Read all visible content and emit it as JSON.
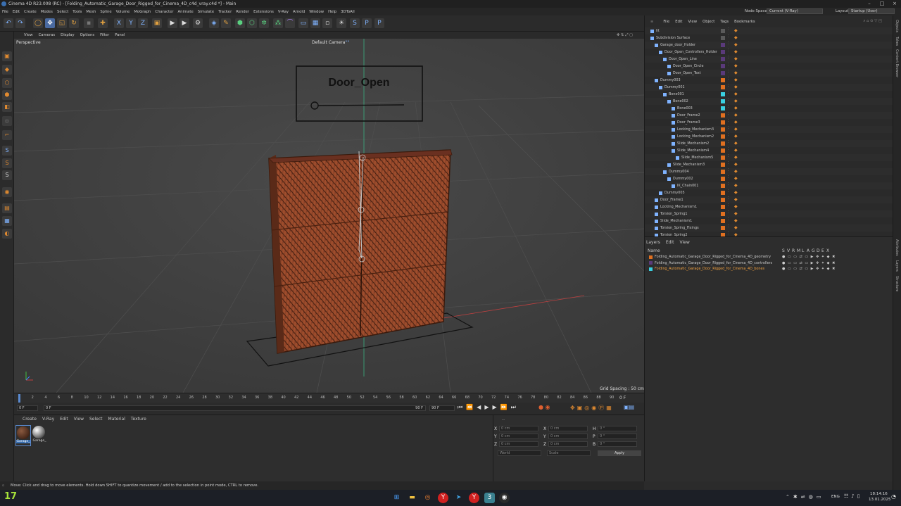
{
  "titlebar": {
    "title": "Cinema 4D R23.008 (RC) - [Folding_Automatic_Garage_Door_Rigged_for_Cinema_4D_c4d_vray.c4d *] - Main"
  },
  "menubar": {
    "items": [
      "File",
      "Edit",
      "Create",
      "Modes",
      "Select",
      "Tools",
      "Mesh",
      "Spline",
      "Volume",
      "MoGraph",
      "Character",
      "Animate",
      "Simulate",
      "Tracker",
      "Render",
      "Extensions",
      "V-Ray",
      "Arnold",
      "Window",
      "Help",
      "3DToAll"
    ],
    "node_space_label": "Node Space:",
    "node_space_value": "Current (V-Ray)",
    "layout_label": "Layout:",
    "layout_value": "Startup (User)"
  },
  "viewport": {
    "menu": [
      "View",
      "Cameras",
      "Display",
      "Options",
      "Filter",
      "Panel"
    ],
    "view_name": "Perspective",
    "camera": "Default Camera",
    "camera_suffix": "°°",
    "grid_spacing": "Grid Spacing : 50 cm",
    "sign_text": "Door_Open"
  },
  "timeline": {
    "ticks": [
      "0",
      "2",
      "4",
      "6",
      "8",
      "10",
      "12",
      "14",
      "16",
      "18",
      "20",
      "22",
      "24",
      "26",
      "28",
      "30",
      "32",
      "34",
      "36",
      "38",
      "40",
      "42",
      "44",
      "46",
      "48",
      "50",
      "52",
      "54",
      "56",
      "58",
      "60",
      "62",
      "64",
      "66",
      "68",
      "70",
      "72",
      "74",
      "76",
      "78",
      "80",
      "82",
      "84",
      "86",
      "88",
      "90"
    ],
    "current_frame": "0 F"
  },
  "transport": {
    "start": "0 F",
    "range_start": "0 F",
    "range_end": "90 F",
    "end": "90 F"
  },
  "materials": {
    "menu": [
      "Create",
      "V-Ray",
      "Edit",
      "View",
      "Select",
      "Material",
      "Texture"
    ],
    "items": [
      {
        "name": "Garage_"
      },
      {
        "name": "Garage_"
      }
    ]
  },
  "coordinates": {
    "header": "--",
    "rows": [
      {
        "a": "X",
        "av": "0 cm",
        "b": "X",
        "bv": "0 cm",
        "c": "H",
        "cv": "0 °"
      },
      {
        "a": "Y",
        "av": "0 cm",
        "b": "Y",
        "bv": "0 cm",
        "c": "P",
        "cv": "0 °"
      },
      {
        "a": "Z",
        "av": "0 cm",
        "b": "Z",
        "bv": "0 cm",
        "c": "B",
        "cv": "0 °"
      }
    ],
    "mode": "World",
    "type": "Scale",
    "apply": "Apply"
  },
  "statusbar": {
    "text": "Move: Click and drag to move elements. Hold down SHIFT to quantize movement / add to the selection in point mode, CTRL to remove."
  },
  "objects": {
    "menu": [
      "File",
      "Edit",
      "View",
      "Object",
      "Tags",
      "Bookmarks"
    ],
    "rows": [
      {
        "name": "lit",
        "indent": 0,
        "layer": "#5a5a5a"
      },
      {
        "name": "Subdivision Surface",
        "indent": 0,
        "layer": "#5a5a5a"
      },
      {
        "name": "Garage_door_Holder",
        "indent": 1,
        "layer": "#5a3a7a"
      },
      {
        "name": "Door_Open_Controllers_Holder",
        "indent": 2,
        "layer": "#5a3a7a"
      },
      {
        "name": "Door_Open_Line",
        "indent": 3,
        "layer": "#5a3a7a"
      },
      {
        "name": "Door_Open_Circle",
        "indent": 4,
        "layer": "#5a3a7a"
      },
      {
        "name": "Door_Open_Text",
        "indent": 4,
        "layer": "#5a3a7a"
      },
      {
        "name": "Dummy003",
        "indent": 1,
        "layer": "#e07020"
      },
      {
        "name": "Dummy001",
        "indent": 2,
        "layer": "#e07020"
      },
      {
        "name": "Bone001",
        "indent": 3,
        "layer": "#3ad0e0"
      },
      {
        "name": "Bone002",
        "indent": 4,
        "layer": "#3ad0e0"
      },
      {
        "name": "Bone003",
        "indent": 5,
        "layer": "#3ad0e0"
      },
      {
        "name": "Door_Frame2",
        "indent": 5,
        "layer": "#e07020"
      },
      {
        "name": "Door_Frame3",
        "indent": 5,
        "layer": "#e07020"
      },
      {
        "name": "Locking_Mechanism3",
        "indent": 5,
        "layer": "#e07020"
      },
      {
        "name": "Locking_Mechanism2",
        "indent": 5,
        "layer": "#e07020"
      },
      {
        "name": "Slide_Mechanism2",
        "indent": 5,
        "layer": "#e07020"
      },
      {
        "name": "Slide_Mechanism4",
        "indent": 5,
        "layer": "#e07020"
      },
      {
        "name": "Slide_Mechanism5",
        "indent": 6,
        "layer": "#e07020"
      },
      {
        "name": "Slide_Mechanism3",
        "indent": 4,
        "layer": "#e07020"
      },
      {
        "name": "Dummy004",
        "indent": 3,
        "layer": "#e07020"
      },
      {
        "name": "Dummy002",
        "indent": 4,
        "layer": "#e07020"
      },
      {
        "name": "IK_Chain001",
        "indent": 5,
        "layer": "#e07020"
      },
      {
        "name": "Dummy005",
        "indent": 2,
        "layer": "#e07020"
      },
      {
        "name": "Door_Frame1",
        "indent": 1,
        "layer": "#e07020"
      },
      {
        "name": "Locking_Mechanism1",
        "indent": 1,
        "layer": "#e07020"
      },
      {
        "name": "Torsion_Spring1",
        "indent": 1,
        "layer": "#e07020"
      },
      {
        "name": "Slide_Mechanism1",
        "indent": 1,
        "layer": "#e07020"
      },
      {
        "name": "Torsion_Spring_Fixings",
        "indent": 1,
        "layer": "#e07020"
      },
      {
        "name": "Torsion_Spring2",
        "indent": 1,
        "layer": "#e07020"
      }
    ]
  },
  "layers": {
    "menu": [
      "Layers",
      "Edit",
      "View"
    ],
    "header_name": "Name",
    "header_cols": [
      "S",
      "V",
      "R",
      "M",
      "L",
      "A",
      "G",
      "D",
      "E",
      "X"
    ],
    "rows": [
      {
        "name": "Folding_Automatic_Garage_Door_Rigged_for_Cinema_4D_geometry",
        "color": "#e07020"
      },
      {
        "name": "Folding_Automatic_Garage_Door_Rigged_for_Cinema_4D_controllers",
        "color": "#5a3a7a"
      },
      {
        "name": "Folding_Automatic_Garage_Door_Rigged_for_Cinema_4D_bones",
        "color": "#3ad0e0"
      }
    ]
  },
  "right_tabs": [
    "Objects",
    "Takes",
    "Content Browser",
    "Attributes",
    "Layers",
    "Structure"
  ],
  "taskbar": {
    "badge": "17",
    "lang": "ENG",
    "time": "18:14:16",
    "date": "13.01.2025"
  },
  "colors": {
    "accent": "#e07020",
    "bone": "#3ad0e0",
    "controller": "#5a3a7a",
    "selected_text": "#f0a040"
  }
}
